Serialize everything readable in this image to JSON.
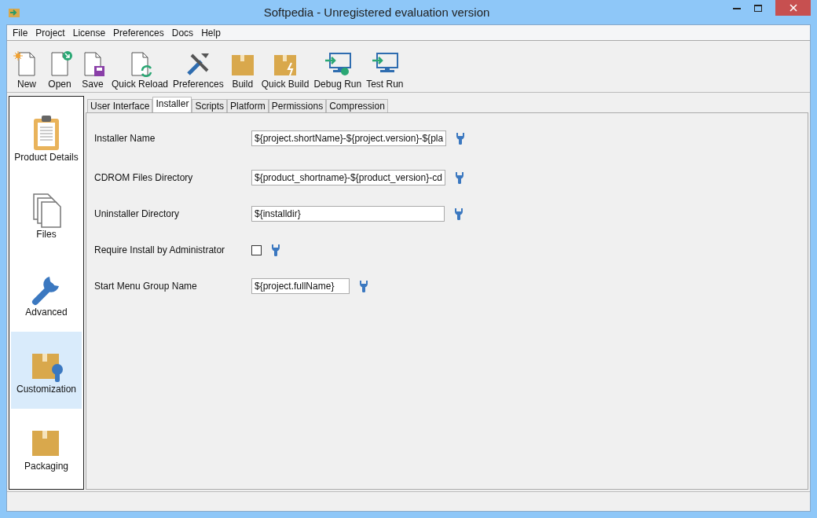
{
  "window": {
    "title": "Softpedia - Unregistered evaluation version"
  },
  "menu": [
    "File",
    "Project",
    "License",
    "Preferences",
    "Docs",
    "Help"
  ],
  "toolbar": [
    "New",
    "Open",
    "Save",
    "Quick Reload",
    "Preferences",
    "Build",
    "Quick Build",
    "Debug Run",
    "Test Run"
  ],
  "sidebar": {
    "items": [
      {
        "label": "Product Details",
        "selected": false
      },
      {
        "label": "Files",
        "selected": false
      },
      {
        "label": "Advanced",
        "selected": false
      },
      {
        "label": "Customization",
        "selected": true
      },
      {
        "label": "Packaging",
        "selected": false
      }
    ]
  },
  "tabs": [
    {
      "label": "User Interface",
      "selected": false
    },
    {
      "label": "Installer",
      "selected": true
    },
    {
      "label": "Scripts",
      "selected": false
    },
    {
      "label": "Platform",
      "selected": false
    },
    {
      "label": "Permissions",
      "selected": false
    },
    {
      "label": "Compression",
      "selected": false
    }
  ],
  "fields": [
    {
      "label": "Installer Name",
      "kind": "text",
      "value": "${project.shortName}-${project.version}-${pla"
    },
    {
      "label": "CDROM Files Directory",
      "kind": "text",
      "value": "${product_shortname}-${product_version}-cd"
    },
    {
      "label": "Uninstaller Directory",
      "kind": "text",
      "value": "${installdir}"
    },
    {
      "label": "Require Install by Administrator",
      "kind": "checkbox",
      "checked": false
    },
    {
      "label": "Start Menu Group Name",
      "kind": "short_text",
      "value": "${project.fullName}"
    }
  ]
}
